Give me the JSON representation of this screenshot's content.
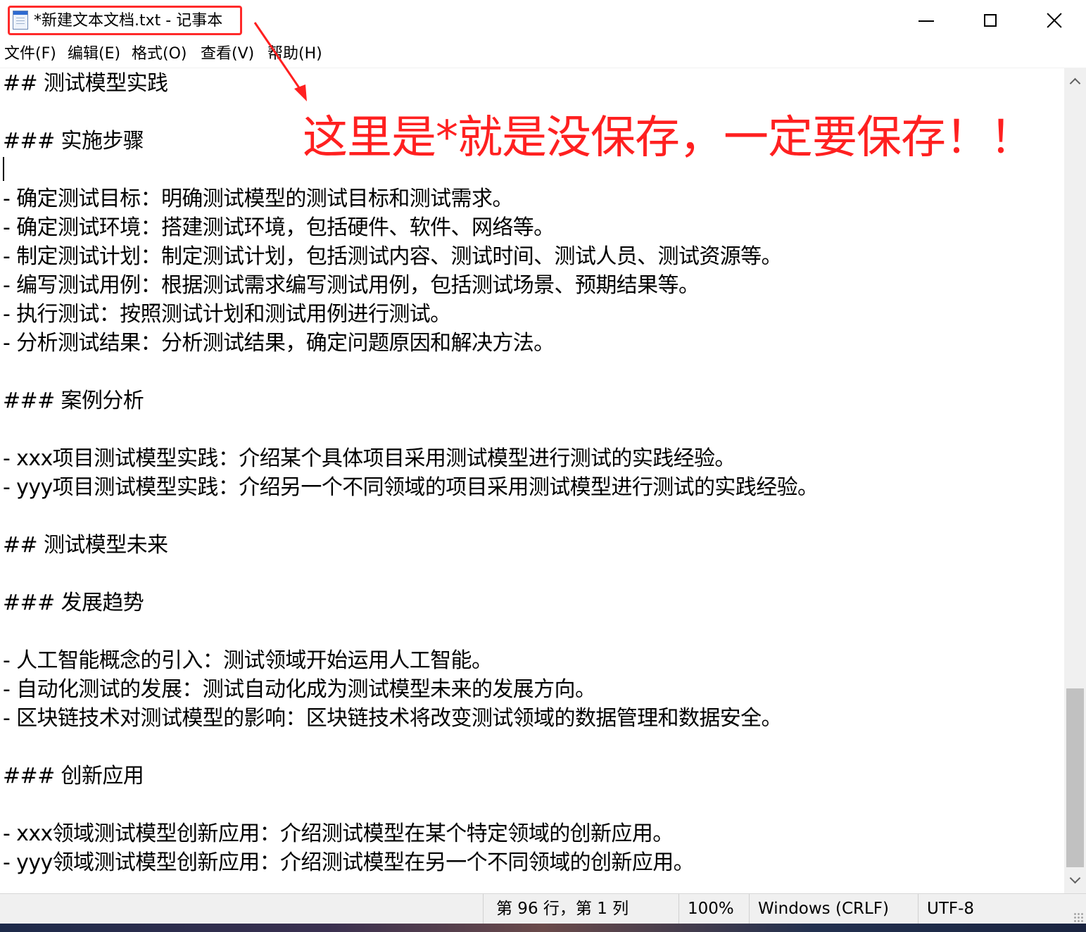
{
  "window": {
    "title": "*新建文本文档.txt - 记事本"
  },
  "menu": {
    "file": "文件(F)",
    "edit": "编辑(E)",
    "format": "格式(O)",
    "view": "查看(V)",
    "help": "帮助(H)"
  },
  "document": {
    "lines": [
      "## 测试模型实践",
      "",
      "### 实施步骤",
      "",
      "- 确定测试目标：明确测试模型的测试目标和测试需求。",
      "- 确定测试环境：搭建测试环境，包括硬件、软件、网络等。",
      "- 制定测试计划：制定测试计划，包括测试内容、测试时间、测试人员、测试资源等。",
      "- 编写测试用例：根据测试需求编写测试用例，包括测试场景、预期结果等。",
      "- 执行测试：按照测试计划和测试用例进行测试。",
      "- 分析测试结果：分析测试结果，确定问题原因和解决方法。",
      "",
      "### 案例分析",
      "",
      "- xxx项目测试模型实践：介绍某个具体项目采用测试模型进行测试的实践经验。",
      "- yyy项目测试模型实践：介绍另一个不同领域的项目采用测试模型进行测试的实践经验。",
      "",
      "## 测试模型未来",
      "",
      "### 发展趋势",
      "",
      "- 人工智能概念的引入：测试领域开始运用人工智能。",
      "- 自动化测试的发展：测试自动化成为测试模型未来的发展方向。",
      "- 区块链技术对测试模型的影响：区块链技术将改变测试领域的数据管理和数据安全。",
      "",
      "### 创新应用",
      "",
      "- xxx领域测试模型创新应用：介绍测试模型在某个特定领域的创新应用。",
      "- yyy领域测试模型创新应用：介绍测试模型在另一个不同领域的创新应用。"
    ]
  },
  "annotation": {
    "text": "这里是*就是没保存，一定要保存！！",
    "color": "#ff2020"
  },
  "status": {
    "position": "第 96 行，第 1 列",
    "zoom": "100%",
    "line_ending": "Windows (CRLF)",
    "encoding": "UTF-8"
  },
  "icons": {
    "app": "notepad-icon",
    "minimize": "minimize-icon",
    "maximize": "maximize-icon",
    "close": "close-icon",
    "scroll_up": "chevron-up-icon",
    "scroll_down": "chevron-down-icon"
  }
}
